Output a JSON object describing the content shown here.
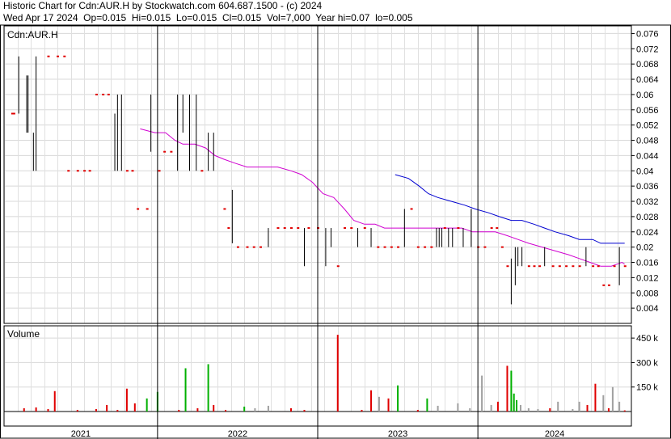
{
  "header": {
    "line1": "Historic Chart for Cdn:AUR.H by Stockwatch.com 604.687.1500 - (c) 2024",
    "line2": "Wed Apr 17 2024  Op=0.015  Hi=0.015  Lo=0.015  Cl=0.015  Vol=7,000  Year hi=0.07  lo=0.005"
  },
  "chart_data": [
    {
      "type": "line",
      "title": "Cdn:AUR.H",
      "ylim": [
        0.0,
        0.078
      ],
      "yticks": [
        "0.076",
        "0.072",
        "0.068",
        "0.064",
        "0.06",
        "0.056",
        "0.052",
        "0.048",
        "0.044",
        "0.04",
        "0.036",
        "0.032",
        "0.028",
        "0.024",
        "0.02",
        "0.016",
        "0.012",
        "0.008",
        "0.004"
      ],
      "x_labels": [
        "2021",
        "2022",
        "2023",
        "2024"
      ],
      "grid": true,
      "colors": {
        "bars": "#000000",
        "no_trade": "#e00000",
        "ma_short": "#d000d0",
        "ma_long": "#0000d0"
      },
      "bars": [
        [
          0.1,
          0.055,
          0.055
        ],
        [
          0.22,
          0.055,
          0.055
        ],
        [
          0.6,
          0.055,
          0.07
        ],
        [
          1.2,
          0.05,
          0.065
        ],
        [
          1.3,
          0.05,
          0.065
        ],
        [
          1.7,
          0.04,
          0.05
        ],
        [
          1.9,
          0.04,
          0.07
        ],
        [
          2.8,
          0.07,
          0.07
        ],
        [
          3.5,
          0.07,
          0.07
        ],
        [
          4.0,
          0.07,
          0.07
        ],
        [
          4.3,
          0.04,
          0.04
        ],
        [
          5.0,
          0.04,
          0.04
        ],
        [
          5.5,
          0.04,
          0.04
        ],
        [
          5.9,
          0.04,
          0.04
        ],
        [
          6.4,
          0.06,
          0.06
        ],
        [
          6.9,
          0.06,
          0.06
        ],
        [
          7.3,
          0.06,
          0.06
        ],
        [
          7.8,
          0.04,
          0.055
        ],
        [
          8.0,
          0.04,
          0.06
        ],
        [
          8.3,
          0.04,
          0.06
        ],
        [
          8.7,
          0.04,
          0.04
        ],
        [
          9.1,
          0.04,
          0.04
        ],
        [
          9.5,
          0.03,
          0.03
        ],
        [
          10.2,
          0.03,
          0.03
        ],
        [
          10.5,
          0.045,
          0.06
        ],
        [
          11.1,
          0.04,
          0.04
        ],
        [
          11.5,
          0.045,
          0.045
        ],
        [
          12.0,
          0.045,
          0.045
        ],
        [
          12.5,
          0.04,
          0.06
        ],
        [
          12.9,
          0.05,
          0.06
        ],
        [
          13.4,
          0.04,
          0.06
        ],
        [
          13.9,
          0.04,
          0.06
        ],
        [
          14.3,
          0.04,
          0.04
        ],
        [
          14.8,
          0.04,
          0.05
        ],
        [
          15.2,
          0.04,
          0.05
        ],
        [
          16.0,
          0.03,
          0.03
        ],
        [
          16.3,
          0.025,
          0.025
        ],
        [
          16.6,
          0.021,
          0.035
        ],
        [
          17.0,
          0.02,
          0.02
        ],
        [
          17.7,
          0.02,
          0.02
        ],
        [
          18.2,
          0.02,
          0.02
        ],
        [
          18.7,
          0.02,
          0.02
        ],
        [
          19.3,
          0.02,
          0.025
        ],
        [
          20.0,
          0.025,
          0.025
        ],
        [
          20.5,
          0.025,
          0.025
        ],
        [
          21.0,
          0.025,
          0.025
        ],
        [
          21.5,
          0.025,
          0.025
        ],
        [
          22.0,
          0.015,
          0.025
        ],
        [
          22.3,
          0.025,
          0.025
        ],
        [
          23.0,
          0.025,
          0.025
        ],
        [
          23.6,
          0.015,
          0.025
        ],
        [
          24.0,
          0.02,
          0.025
        ],
        [
          24.5,
          0.015,
          0.015
        ],
        [
          25.0,
          0.025,
          0.025
        ],
        [
          25.5,
          0.025,
          0.025
        ],
        [
          26.0,
          0.02,
          0.025
        ],
        [
          26.5,
          0.025,
          0.025
        ],
        [
          27.0,
          0.02,
          0.025
        ],
        [
          27.5,
          0.02,
          0.02
        ],
        [
          28.0,
          0.02,
          0.02
        ],
        [
          28.5,
          0.02,
          0.02
        ],
        [
          29.0,
          0.02,
          0.02
        ],
        [
          29.5,
          0.02,
          0.03
        ],
        [
          30.0,
          0.03,
          0.03
        ],
        [
          30.5,
          0.02,
          0.02
        ],
        [
          31.0,
          0.02,
          0.02
        ],
        [
          31.5,
          0.02,
          0.02
        ],
        [
          31.9,
          0.02,
          0.025
        ],
        [
          32.1,
          0.02,
          0.025
        ],
        [
          32.3,
          0.02,
          0.025
        ],
        [
          32.5,
          0.025,
          0.025
        ],
        [
          32.8,
          0.02,
          0.025
        ],
        [
          33.1,
          0.02,
          0.025
        ],
        [
          33.5,
          0.025,
          0.025
        ],
        [
          33.9,
          0.02,
          0.025
        ],
        [
          34.5,
          0.02,
          0.03
        ],
        [
          35.0,
          0.02,
          0.02
        ],
        [
          35.5,
          0.02,
          0.02
        ],
        [
          36.0,
          0.025,
          0.025
        ],
        [
          36.4,
          0.025,
          0.025
        ],
        [
          36.8,
          0.02,
          0.02
        ],
        [
          37.2,
          0.015,
          0.015
        ],
        [
          37.5,
          0.005,
          0.017
        ],
        [
          37.8,
          0.01,
          0.02
        ],
        [
          38.0,
          0.015,
          0.02
        ],
        [
          38.3,
          0.015,
          0.02
        ],
        [
          38.8,
          0.015,
          0.015
        ],
        [
          39.2,
          0.015,
          0.015
        ],
        [
          39.6,
          0.015,
          0.015
        ],
        [
          40.0,
          0.015,
          0.02
        ],
        [
          40.6,
          0.015,
          0.015
        ],
        [
          41.1,
          0.015,
          0.015
        ],
        [
          41.6,
          0.015,
          0.015
        ],
        [
          42.1,
          0.015,
          0.015
        ],
        [
          42.6,
          0.015,
          0.015
        ],
        [
          43.1,
          0.015,
          0.02
        ],
        [
          43.6,
          0.015,
          0.015
        ],
        [
          44.0,
          0.015,
          0.015
        ],
        [
          44.4,
          0.01,
          0.01
        ],
        [
          44.8,
          0.01,
          0.01
        ],
        [
          45.2,
          0.015,
          0.015
        ],
        [
          45.6,
          0.01,
          0.02
        ],
        [
          46.0,
          0.015,
          0.015
        ]
      ],
      "ma_short": [
        [
          9.7,
          0.051
        ],
        [
          10.8,
          0.05
        ],
        [
          11.6,
          0.05
        ],
        [
          12.3,
          0.048
        ],
        [
          12.9,
          0.047
        ],
        [
          13.8,
          0.047
        ],
        [
          14.6,
          0.046
        ],
        [
          15.3,
          0.044
        ],
        [
          16.0,
          0.043
        ],
        [
          16.8,
          0.042
        ],
        [
          17.7,
          0.041
        ],
        [
          18.8,
          0.041
        ],
        [
          20.0,
          0.041
        ],
        [
          21.0,
          0.04
        ],
        [
          21.8,
          0.039
        ],
        [
          22.6,
          0.037
        ],
        [
          23.4,
          0.034
        ],
        [
          24.2,
          0.033
        ],
        [
          25.0,
          0.03
        ],
        [
          25.7,
          0.027
        ],
        [
          26.5,
          0.026
        ],
        [
          27.3,
          0.026
        ],
        [
          28.0,
          0.025
        ],
        [
          29.0,
          0.025
        ],
        [
          30.0,
          0.025
        ],
        [
          31.0,
          0.025
        ],
        [
          32.0,
          0.025
        ],
        [
          33.0,
          0.025
        ],
        [
          33.8,
          0.025
        ],
        [
          34.6,
          0.024
        ],
        [
          35.5,
          0.024
        ],
        [
          36.3,
          0.024
        ],
        [
          37.2,
          0.023
        ],
        [
          38.0,
          0.022
        ],
        [
          38.8,
          0.021
        ],
        [
          39.8,
          0.02
        ],
        [
          40.8,
          0.019
        ],
        [
          41.8,
          0.018
        ],
        [
          42.6,
          0.017
        ],
        [
          43.4,
          0.016
        ],
        [
          44.2,
          0.015
        ],
        [
          45.0,
          0.015
        ],
        [
          45.8,
          0.016
        ],
        [
          46.0,
          0.0155
        ]
      ],
      "ma_long": [
        [
          28.8,
          0.039
        ],
        [
          29.8,
          0.038
        ],
        [
          30.6,
          0.036
        ],
        [
          31.3,
          0.034
        ],
        [
          32.0,
          0.033
        ],
        [
          33.0,
          0.032
        ],
        [
          34.0,
          0.031
        ],
        [
          34.8,
          0.03
        ],
        [
          35.8,
          0.029
        ],
        [
          36.6,
          0.028
        ],
        [
          37.5,
          0.027
        ],
        [
          38.3,
          0.027
        ],
        [
          39.2,
          0.026
        ],
        [
          40.0,
          0.025
        ],
        [
          40.8,
          0.024
        ],
        [
          41.8,
          0.023
        ],
        [
          42.6,
          0.022
        ],
        [
          43.6,
          0.022
        ],
        [
          44.2,
          0.021
        ],
        [
          44.8,
          0.021
        ],
        [
          45.5,
          0.021
        ],
        [
          46.0,
          0.021
        ]
      ]
    },
    {
      "type": "bar",
      "title": "Volume",
      "ylim": [
        0,
        525000
      ],
      "yticks": [
        "450 k",
        "300 k",
        "150 k"
      ],
      "colors": {
        "up": "#00b000",
        "down": "#e00000",
        "flat": "#a0a0a0"
      },
      "volumes": [
        [
          1.0,
          20000,
          "down"
        ],
        [
          1.9,
          25000,
          "down"
        ],
        [
          2.8,
          15000,
          "down"
        ],
        [
          3.3,
          125000,
          "down"
        ],
        [
          5.0,
          10000,
          "down"
        ],
        [
          6.4,
          15000,
          "down"
        ],
        [
          7.2,
          40000,
          "down"
        ],
        [
          8.0,
          10000,
          "down"
        ],
        [
          8.7,
          140000,
          "down"
        ],
        [
          9.3,
          50000,
          "down"
        ],
        [
          10.2,
          80000,
          "up"
        ],
        [
          11.0,
          120000,
          "up"
        ],
        [
          12.6,
          10000,
          "down"
        ],
        [
          13.1,
          265000,
          "up"
        ],
        [
          14.0,
          20000,
          "down"
        ],
        [
          14.8,
          290000,
          "up"
        ],
        [
          15.2,
          40000,
          "down"
        ],
        [
          16.1,
          10000,
          "down"
        ],
        [
          17.5,
          30000,
          "up"
        ],
        [
          18.3,
          20000,
          "flat"
        ],
        [
          19.3,
          35000,
          "flat"
        ],
        [
          21.0,
          20000,
          "down"
        ],
        [
          22.0,
          10000,
          "down"
        ],
        [
          24.5,
          470000,
          "down"
        ],
        [
          26.3,
          10000,
          "down"
        ],
        [
          27.0,
          130000,
          "down"
        ],
        [
          27.6,
          90000,
          "flat"
        ],
        [
          28.3,
          80000,
          "down"
        ],
        [
          29.0,
          160000,
          "up"
        ],
        [
          30.5,
          10000,
          "down"
        ],
        [
          31.2,
          80000,
          "up"
        ],
        [
          32.0,
          35000,
          "flat"
        ],
        [
          33.5,
          50000,
          "flat"
        ],
        [
          34.4,
          20000,
          "flat"
        ],
        [
          35.3,
          220000,
          "flat"
        ],
        [
          36.0,
          40000,
          "flat"
        ],
        [
          36.5,
          60000,
          "down"
        ],
        [
          37.2,
          280000,
          "down"
        ],
        [
          37.5,
          250000,
          "up"
        ],
        [
          37.7,
          110000,
          "up"
        ],
        [
          37.9,
          70000,
          "up"
        ],
        [
          38.2,
          40000,
          "flat"
        ],
        [
          38.8,
          20000,
          "flat"
        ],
        [
          39.5,
          15000,
          "flat"
        ],
        [
          40.4,
          20000,
          "down"
        ],
        [
          41.0,
          60000,
          "flat"
        ],
        [
          42.1,
          15000,
          "flat"
        ],
        [
          42.6,
          60000,
          "flat"
        ],
        [
          43.2,
          40000,
          "down"
        ],
        [
          43.8,
          170000,
          "down"
        ],
        [
          44.4,
          100000,
          "flat"
        ],
        [
          44.8,
          20000,
          "down"
        ],
        [
          45.1,
          150000,
          "flat"
        ],
        [
          45.6,
          60000,
          "flat"
        ],
        [
          46.0,
          7000,
          "down"
        ]
      ]
    }
  ]
}
